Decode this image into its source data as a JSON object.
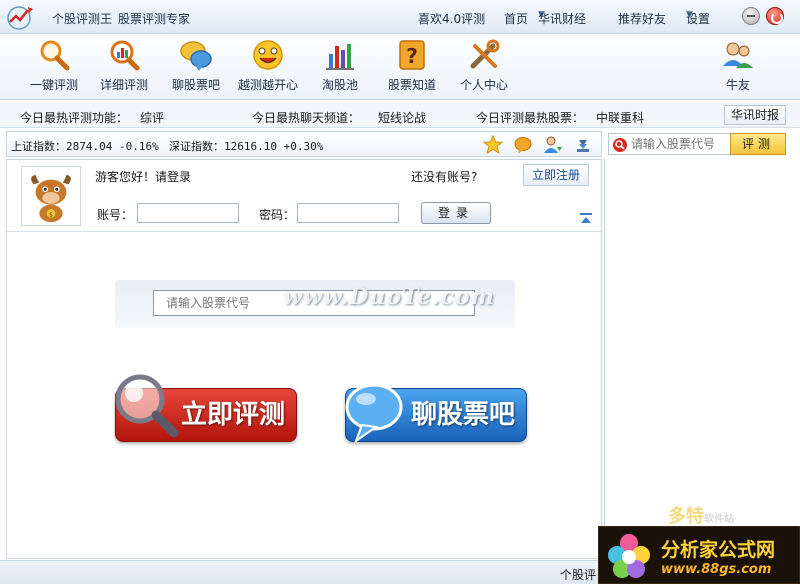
{
  "window": {
    "title": "个股评测王",
    "subtitle": "股票评测专家",
    "links": [
      "喜欢4.0评测",
      "首页",
      "华讯财经",
      "推荐好友",
      "设置"
    ]
  },
  "toolbar": {
    "items": [
      {
        "label": "一键评测",
        "icon": "magnifier-icon"
      },
      {
        "label": "详细评测",
        "icon": "chart-magnifier-icon"
      },
      {
        "label": "聊股票吧",
        "icon": "chat-bubbles-icon"
      },
      {
        "label": "越测越开心",
        "icon": "smiley-icon"
      },
      {
        "label": "淘股池",
        "icon": "bar-chart-icon"
      },
      {
        "label": "股票知道",
        "icon": "question-icon"
      },
      {
        "label": "个人中心",
        "icon": "tools-icon"
      },
      {
        "label": "牛友",
        "icon": "friends-icon"
      }
    ]
  },
  "infobar": {
    "hot_feature_label": "今日最热评测功能：",
    "hot_feature_value": "综评",
    "hot_channel_label": "今日最热聊天频道：",
    "hot_channel_value": "短线论战",
    "hot_stock_label": "今日评测最热股票：",
    "hot_stock_value": "中联重科",
    "news_button": "华讯时报"
  },
  "indices": {
    "sh": "上证指数：2874.04 -0.16%",
    "sz": "深证指数：12616.10 +0.30%"
  },
  "search": {
    "placeholder": "请输入股票代号",
    "button": "评测"
  },
  "login": {
    "greeting": "游客您好！请登录",
    "no_account": "还没有账号?",
    "register": "立即注册",
    "account_label": "账号：",
    "password_label": "密码：",
    "login_button": "登录"
  },
  "main": {
    "code_placeholder": "请输入股票代号",
    "watermark": "www.DuoTe.com",
    "evaluate_button": "立即评测",
    "chat_button": "聊股票吧"
  },
  "status": {
    "text": "个股评"
  },
  "badges": {
    "site_name": "分析家公式网",
    "site_url": "www.88gs.com",
    "duote_name": "多特",
    "duote_sub": "软件站"
  },
  "colors": {
    "accent": "#1a62b8",
    "red_button": "#c21d12",
    "blue_button": "#2a7ad0",
    "search_button": "#f4c23a"
  }
}
